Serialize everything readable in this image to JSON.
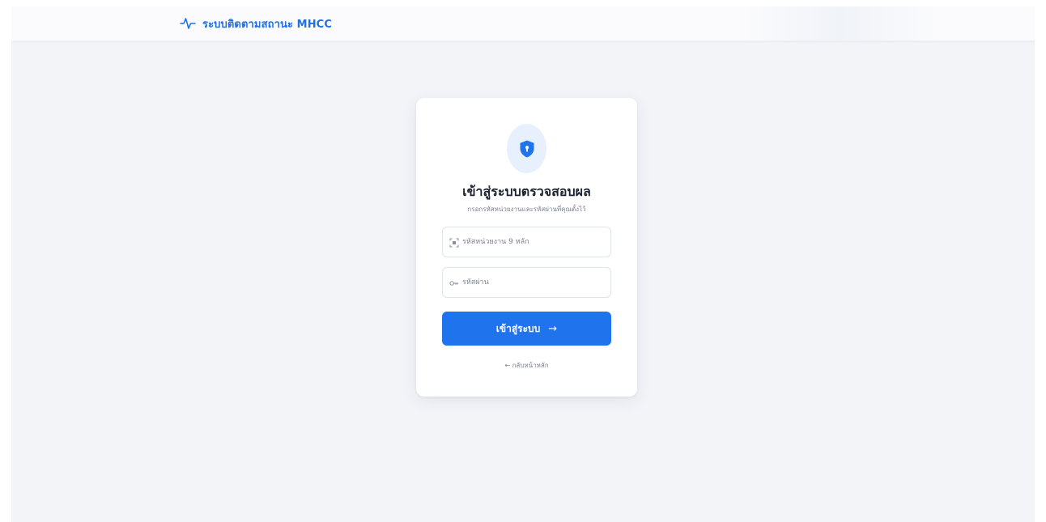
{
  "header": {
    "title": "ระบบติดตามสถานะ MHCC",
    "icon": "pulse-icon"
  },
  "login": {
    "badge_icon": "shield-lock-icon",
    "title": "เข้าสู่ระบบตรวจสอบผล",
    "subtitle": "กรอกรหัสหน่วยงานและรหัสผ่านที่คุณตั้งไว้",
    "org_code": {
      "icon": "scan-id-icon",
      "placeholder": "รหัสหน่วยงาน 9 หลัก",
      "value": ""
    },
    "password": {
      "icon": "key-icon",
      "placeholder": "รหัสผ่าน",
      "value": ""
    },
    "submit": {
      "label": "เข้าสู่ระบบ",
      "arrow": "→"
    },
    "back": "← กลับหน้าหลัก"
  },
  "colors": {
    "accent": "#1f74ee",
    "brand_text": "#1f6fe6",
    "badge_bg": "#e9f0fd",
    "page_bg": "#f3f4f8"
  }
}
